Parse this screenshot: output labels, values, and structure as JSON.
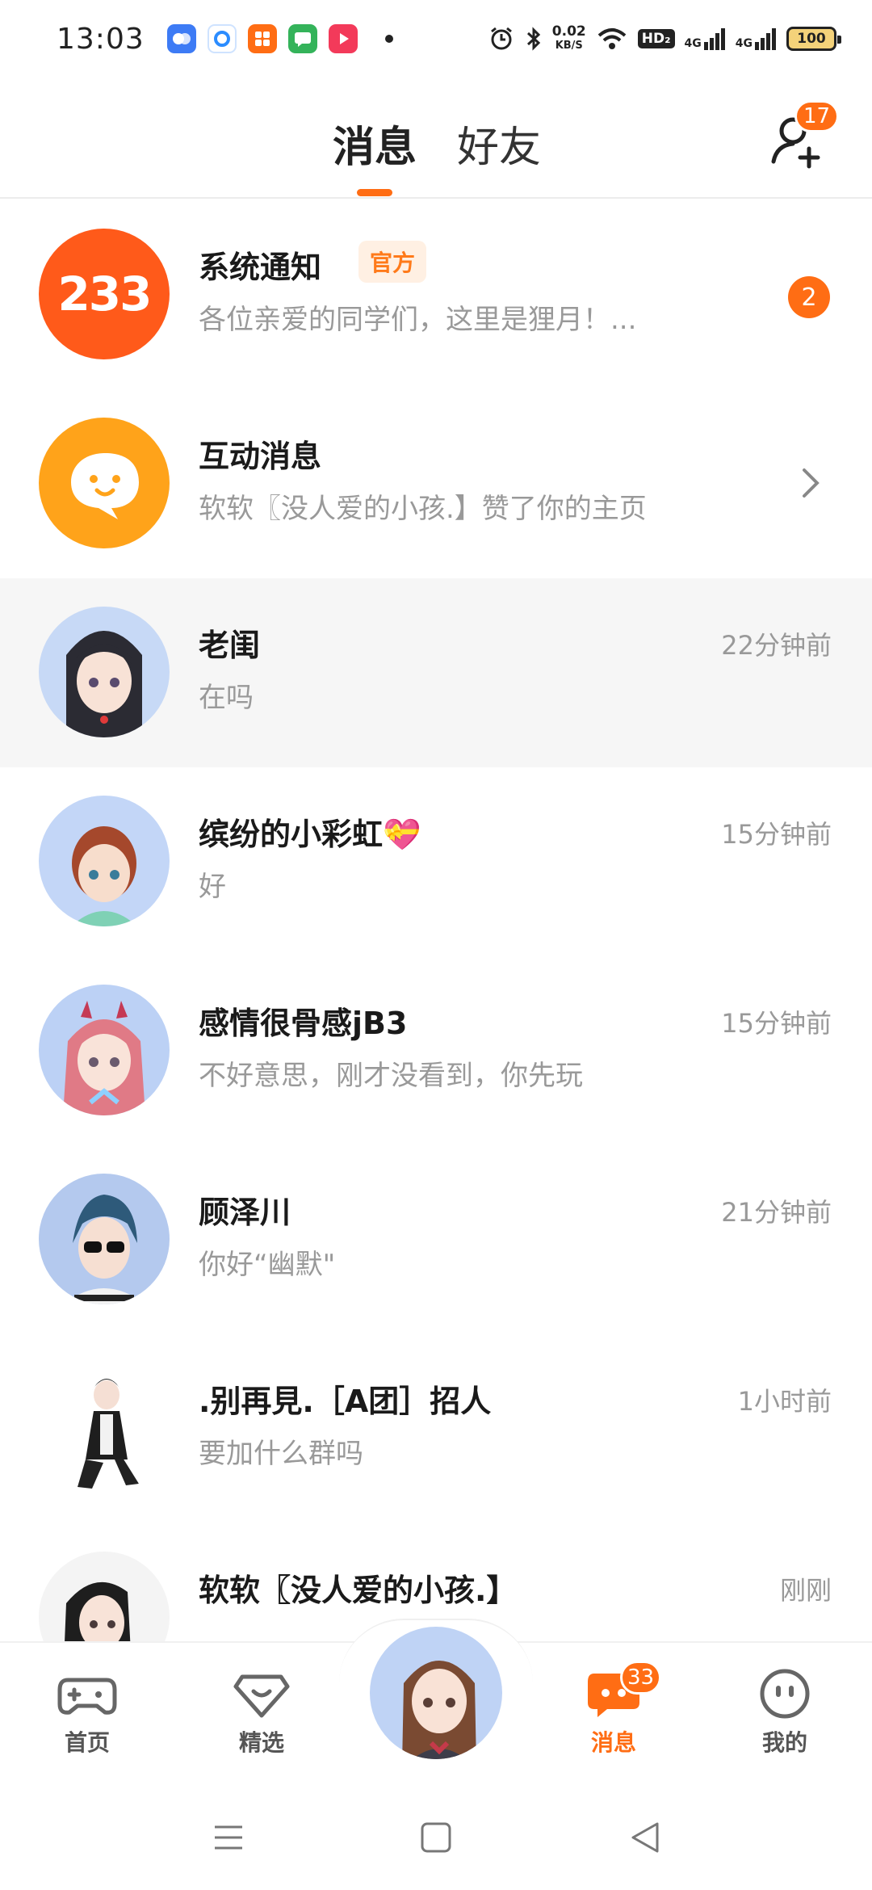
{
  "status_bar": {
    "time": "13:03",
    "net_speed_value": "0.02",
    "net_speed_unit": "KB/S",
    "hd_label": "HD₂",
    "signal_1": "4G",
    "signal_2": "4G",
    "battery": "100"
  },
  "header": {
    "tab_messages": "消息",
    "tab_friends": "好友",
    "add_friend_badge": "17"
  },
  "conversations": [
    {
      "name": "系统通知",
      "tag": "官方",
      "preview": "各位亲爱的同学们，这里是狸月！...",
      "unread": "2",
      "avatar_text": "233"
    },
    {
      "name": "互动消息",
      "preview": "软软〖没人爱的小孩.】赞了你的主页"
    },
    {
      "name": "老闺",
      "preview": "在吗",
      "time": "22分钟前"
    },
    {
      "name": "缤纷的小彩虹💝",
      "preview": "好",
      "time": "15分钟前"
    },
    {
      "name": "感情很骨感jB3",
      "preview": "不好意思，刚才没看到，你先玩",
      "time": "15分钟前"
    },
    {
      "name": "顾泽川",
      "preview": "你好“幽默\"",
      "time": "21分钟前"
    },
    {
      "name": ".别再見.［A团］招人",
      "preview": "要加什么群吗",
      "time": "1小时前"
    },
    {
      "name": "软软〖没人爱的小孩.】",
      "preview": "",
      "time": "刚刚"
    }
  ],
  "bottom_nav": {
    "home": "首页",
    "featured": "精选",
    "messages": "消息",
    "messages_badge": "33",
    "mine": "我的"
  },
  "colors": {
    "accent": "#ff6d14",
    "muted_text": "#999999"
  }
}
